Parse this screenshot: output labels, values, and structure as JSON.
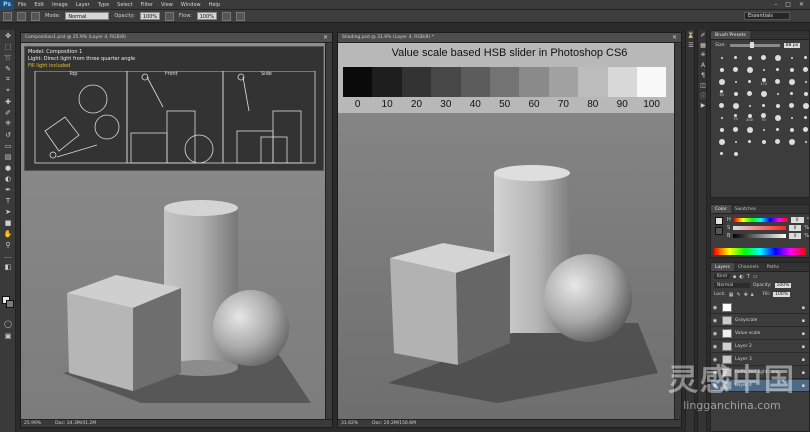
{
  "app": {
    "logo": "Ps",
    "menu": [
      "File",
      "Edit",
      "Image",
      "Layer",
      "Type",
      "Select",
      "Filter",
      "View",
      "Window",
      "Help"
    ]
  },
  "options": {
    "mode_label": "Mode:",
    "mode_value": "Normal",
    "opacity_label": "Opacity:",
    "opacity_value": "100%",
    "flow_label": "Flow:",
    "flow_value": "100%",
    "workspace": "Essentials"
  },
  "doc_left": {
    "tab": "Composition1.psd @ 25.9% (Layer 4, RGB/8)",
    "composition": "Model: Composition 1",
    "light": "Light: Direct light from three quarter angle",
    "fill": "Fill light included",
    "views": [
      "Top",
      "Front",
      "Side"
    ],
    "zoom": "25.99%",
    "doc_size": "Doc: 34.3M/41.2M"
  },
  "doc_right": {
    "tab": "Shading.psd @ 31.6% (Layer 4, RGB/8) *",
    "title": "Value scale based HSB slider in Photoshop CS6",
    "scale_values": [
      "0",
      "10",
      "20",
      "30",
      "40",
      "50",
      "60",
      "70",
      "80",
      "90",
      "100"
    ],
    "scale_colors": [
      "#0a0a0a",
      "#1e1e1e",
      "#333333",
      "#474747",
      "#5c5c5c",
      "#737373",
      "#8a8a8a",
      "#a1a1a1",
      "#bcbcbc",
      "#d8d8d8",
      "#f8f8f8"
    ],
    "zoom": "31.62%",
    "doc_size": "Doc: 20.2M/156.6M"
  },
  "brush_panel": {
    "tabs": [
      "Brush Presets"
    ],
    "size_label": "Size:",
    "size_value": "88 px",
    "sizes": [
      "",
      "",
      "",
      "",
      "",
      "",
      "",
      "",
      "",
      "",
      "",
      "",
      "",
      "",
      "",
      "",
      "",
      "174",
      "",
      "",
      "",
      "30",
      "",
      "",
      "",
      "",
      "",
      "",
      "",
      "",
      "",
      "",
      "",
      "",
      "",
      "",
      "70",
      "200",
      "70",
      "",
      "",
      "",
      "",
      "",
      "",
      "",
      "",
      "",
      "",
      "",
      "",
      "",
      "",
      "",
      "",
      "",
      "",
      ""
    ]
  },
  "color_panel": {
    "tabs": [
      "Color",
      "Swatches"
    ],
    "channels": [
      {
        "label": "H",
        "value": "0",
        "unit": "°"
      },
      {
        "label": "S",
        "value": "0",
        "unit": "%"
      },
      {
        "label": "B",
        "value": "0",
        "unit": "%"
      }
    ]
  },
  "layers_panel": {
    "tabs": [
      "Layers",
      "Channels",
      "Paths"
    ],
    "kind_label": "Kind",
    "blend_mode": "Normal",
    "opacity_label": "Opacity:",
    "opacity_value": "100%",
    "lock_label": "Lock:",
    "fill_label": "Fill:",
    "fill_value": "100%",
    "layers": [
      {
        "name": "",
        "thumb": "#ffffff"
      },
      {
        "name": "Grayscale",
        "thumb": "#cccccc"
      },
      {
        "name": "Value scale",
        "thumb": "#f0f0f0"
      },
      {
        "name": "Layer 2",
        "thumb": "#d0d0d0"
      },
      {
        "name": "Layer 3",
        "thumb": "#c8c8c8"
      },
      {
        "name": "Reflected light cons...",
        "thumb": "#bbbbbb"
      },
      {
        "name": "Layer 4",
        "thumb": "#9aa7b4",
        "selected": true
      }
    ]
  },
  "watermark": {
    "text": "灵感中国",
    "url": "lingganchina.com"
  }
}
